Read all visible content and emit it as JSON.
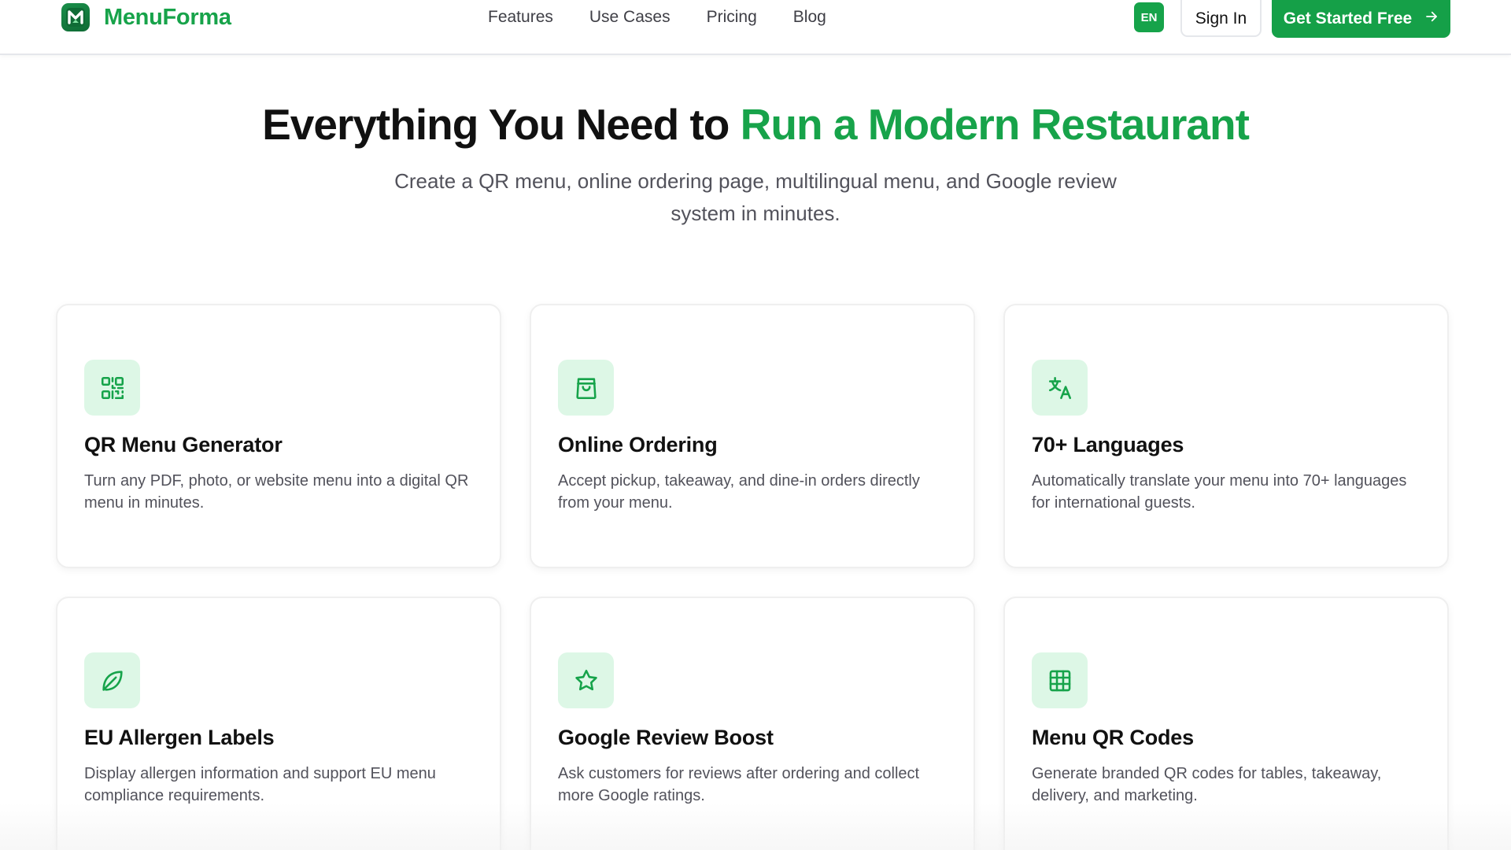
{
  "brand": {
    "name": "MenuForma",
    "logo_letter": "M",
    "accent_color": "#17a34a"
  },
  "nav": {
    "items": [
      {
        "label": "Features"
      },
      {
        "label": "Use Cases"
      },
      {
        "label": "Pricing"
      },
      {
        "label": "Blog"
      }
    ]
  },
  "header": {
    "language": "EN",
    "sign_in_label": "Sign In",
    "cta_label": "Get Started Free",
    "cta_icon": "arrow-right-icon"
  },
  "hero": {
    "title_prefix": "Everything You Need to",
    "title_accent": "Run a Modern Restaurant",
    "subtitle": "Create a QR menu, online ordering page, multilingual menu, and Google review system in minutes."
  },
  "features": [
    {
      "icon": "qr-code-icon",
      "title": "QR Menu Generator",
      "description": "Turn any PDF, photo, or website menu into a digital QR menu in minutes."
    },
    {
      "icon": "shopping-bag-icon",
      "title": "Online Ordering",
      "description": "Accept pickup, takeaway, and dine-in orders directly from your menu."
    },
    {
      "icon": "translate-icon",
      "title": "70+ Languages",
      "description": "Automatically translate your menu into 70+ languages for international guests."
    },
    {
      "icon": "leaf-icon",
      "title": "EU Allergen Labels",
      "description": "Display allergen information and support EU menu compliance requirements."
    },
    {
      "icon": "star-icon",
      "title": "Google Review Boost",
      "description": "Ask customers for reviews after ordering and collect more Google ratings."
    },
    {
      "icon": "grid-icon",
      "title": "Menu QR Codes",
      "description": "Generate branded QR codes for tables, takeaway, delivery, and marketing."
    }
  ]
}
